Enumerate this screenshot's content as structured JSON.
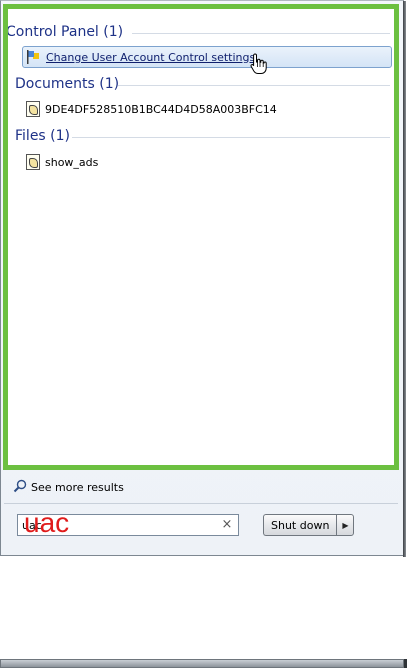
{
  "results": {
    "groups": [
      {
        "header": "Control Panel (1)",
        "items": [
          {
            "label": "Change User Account Control settings",
            "icon": "uac-flag-icon",
            "selected": true
          }
        ]
      },
      {
        "header": "Documents (1)",
        "items": [
          {
            "label": "9DE4DF528510B1BC44D4D58A003BFC14",
            "icon": "script-file-icon",
            "selected": false
          }
        ]
      },
      {
        "header": "Files (1)",
        "items": [
          {
            "label": "show_ads",
            "icon": "script-file-icon",
            "selected": false
          }
        ]
      }
    ]
  },
  "see_more": {
    "label": "See more results",
    "icon": "search-icon"
  },
  "search": {
    "value": "uac",
    "overlay_text": "uac",
    "clear_icon": "close-icon"
  },
  "power": {
    "shutdown_label": "Shut down",
    "arrow_icon": "chevron-right-icon"
  },
  "colors": {
    "highlight_border": "#6cc040",
    "group_header": "#1e3287",
    "overlay_text": "#e01b1b"
  }
}
